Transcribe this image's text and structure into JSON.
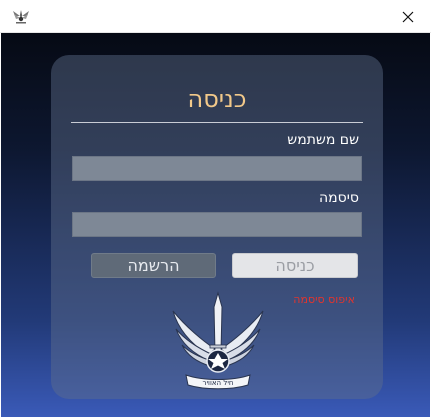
{
  "window": {
    "close_icon": "close-icon",
    "app_icon": "app-icon"
  },
  "login": {
    "title": "כניסה",
    "username_label": "שם משתמש",
    "username_value": "",
    "password_label": "סיסמה",
    "password_value": "",
    "login_button": "כניסה",
    "register_button": "הרשמה",
    "reset_password_link": "איפוס סיסמה",
    "emblem_text": "חיל האוויר"
  },
  "colors": {
    "title": "#f2c98a",
    "reset_link": "#e0352f",
    "background_top": "#060a14",
    "background_bottom": "#3a5ab8"
  }
}
